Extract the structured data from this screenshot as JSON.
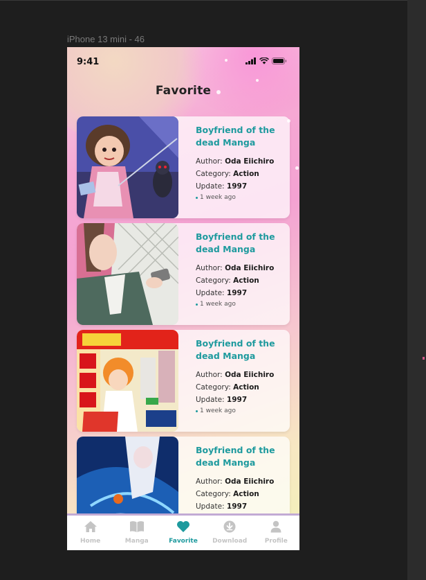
{
  "frame_label": "iPhone 13 mini - 46",
  "status_bar": {
    "time": "9:41"
  },
  "page_title": "Favorite",
  "cards": [
    {
      "title": "Boyfriend of the dead Manga",
      "author_label": "Author:",
      "author": "Oda Eiichiro",
      "category_label": "Category:",
      "category": "Action",
      "update_label": "Update:",
      "update": "1997",
      "ago": "1 week ago"
    },
    {
      "title": "Boyfriend of the dead Manga",
      "author_label": "Author:",
      "author": "Oda Eiichiro",
      "category_label": "Category:",
      "category": "Action",
      "update_label": "Update:",
      "update": "1997",
      "ago": "1 week ago"
    },
    {
      "title": "Boyfriend of the dead Manga",
      "author_label": "Author:",
      "author": "Oda Eiichiro",
      "category_label": "Category:",
      "category": "Action",
      "update_label": "Update:",
      "update": "1997",
      "ago": "1 week ago"
    },
    {
      "title": "Boyfriend of the dead Manga",
      "author_label": "Author:",
      "author": "Oda Eiichiro",
      "category_label": "Category:",
      "category": "Action",
      "update_label": "Update:",
      "update": "1997"
    }
  ],
  "tabs": [
    {
      "label": "Home",
      "icon": "home-icon",
      "active": false
    },
    {
      "label": "Manga",
      "icon": "book-icon",
      "active": false
    },
    {
      "label": "Favorite",
      "icon": "heart-icon",
      "active": true
    },
    {
      "label": "Download",
      "icon": "download-icon",
      "active": false
    },
    {
      "label": "Profile",
      "icon": "person-icon",
      "active": false
    }
  ],
  "colors": {
    "accent": "#1e9a9e",
    "inactive_tab": "#c4c4c4",
    "canvas": "#1e1e1e"
  }
}
